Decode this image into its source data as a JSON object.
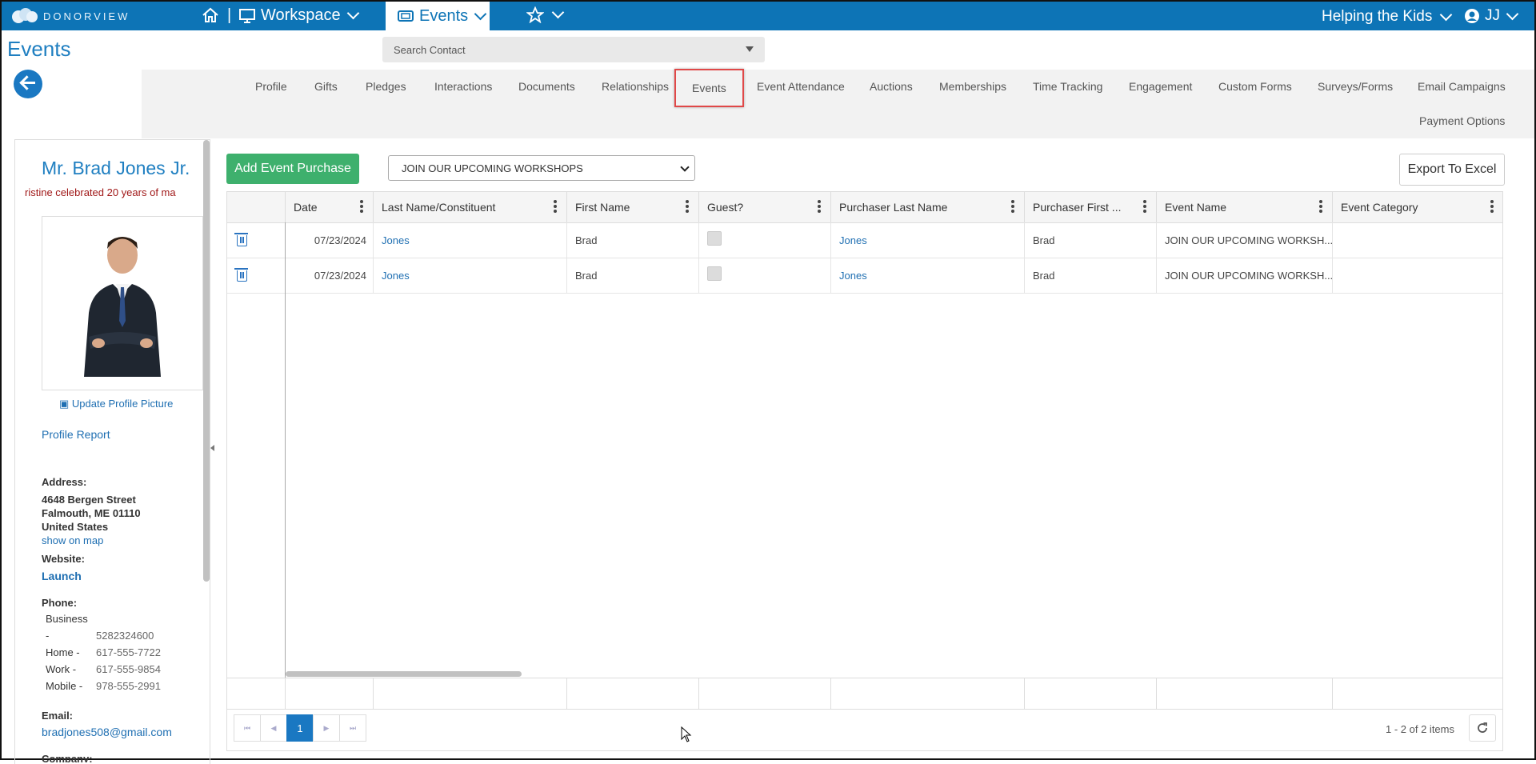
{
  "topbar": {
    "logo_text": "DONORVIEW",
    "workspace_label": "Workspace",
    "events_label": "Events",
    "org_label": "Helping the Kids",
    "user_label": "JJ"
  },
  "page": {
    "title": "Events",
    "search_placeholder": "Search Contact"
  },
  "tabs": [
    {
      "label": "Profile"
    },
    {
      "label": "Gifts"
    },
    {
      "label": "Pledges"
    },
    {
      "label": "Interactions"
    },
    {
      "label": "Documents"
    },
    {
      "label": "Relationships"
    },
    {
      "label": "Events"
    },
    {
      "label": "Event Attendance"
    },
    {
      "label": "Auctions"
    },
    {
      "label": "Memberships"
    },
    {
      "label": "Time Tracking"
    },
    {
      "label": "Engagement"
    },
    {
      "label": "Custom Forms"
    },
    {
      "label": "Surveys/Forms"
    },
    {
      "label": "Email Campaigns"
    },
    {
      "label": "Payment Options"
    }
  ],
  "profile": {
    "name": "Mr. Brad Jones Jr.",
    "tagline": "ristine celebrated 20 years of ma",
    "update_picture": "Update Profile Picture",
    "report_link": "Profile Report",
    "address_label": "Address:",
    "address_line1": "4648 Bergen Street",
    "address_line2": "Falmouth, ME 01110",
    "address_line3": "United States",
    "map_link": "show on map",
    "website_label": "Website:",
    "website_link": "Launch",
    "phone_label": "Phone:",
    "phone_business_label": "Business",
    "phone_business_dash": "-",
    "phone_business": "5282324600",
    "phone_home_label": "Home -",
    "phone_home": "617-555-7722",
    "phone_work_label": "Work -",
    "phone_work": "617-555-9854",
    "phone_mobile_label": "Mobile -",
    "phone_mobile": "978-555-2991",
    "email_label": "Email:",
    "email": "bradjones508@gmail.com",
    "company_label": "Company:"
  },
  "toolbar": {
    "add_button": "Add Event Purchase",
    "event_select": "JOIN OUR UPCOMING WORKSHOPS",
    "export_button": "Export To Excel"
  },
  "grid": {
    "columns": [
      "Date",
      "Last Name/Constituent",
      "First Name",
      "Guest?",
      "Purchaser Last Name",
      "Purchaser First ...",
      "Event Name",
      "Event Category"
    ],
    "rows": [
      {
        "date": "07/23/2024",
        "last": "Jones",
        "first": "Brad",
        "plast": "Jones",
        "pfirst": "Brad",
        "event": "JOIN OUR UPCOMING WORKSH...",
        "category": ""
      },
      {
        "date": "07/23/2024",
        "last": "Jones",
        "first": "Brad",
        "plast": "Jones",
        "pfirst": "Brad",
        "event": "JOIN OUR UPCOMING WORKSH...",
        "category": ""
      }
    ],
    "current_page": "1",
    "count": "1 - 2 of 2 items"
  },
  "colors": {
    "brand": "#0d74b6",
    "add_button": "#3eb06d",
    "tag": "#a01818"
  }
}
